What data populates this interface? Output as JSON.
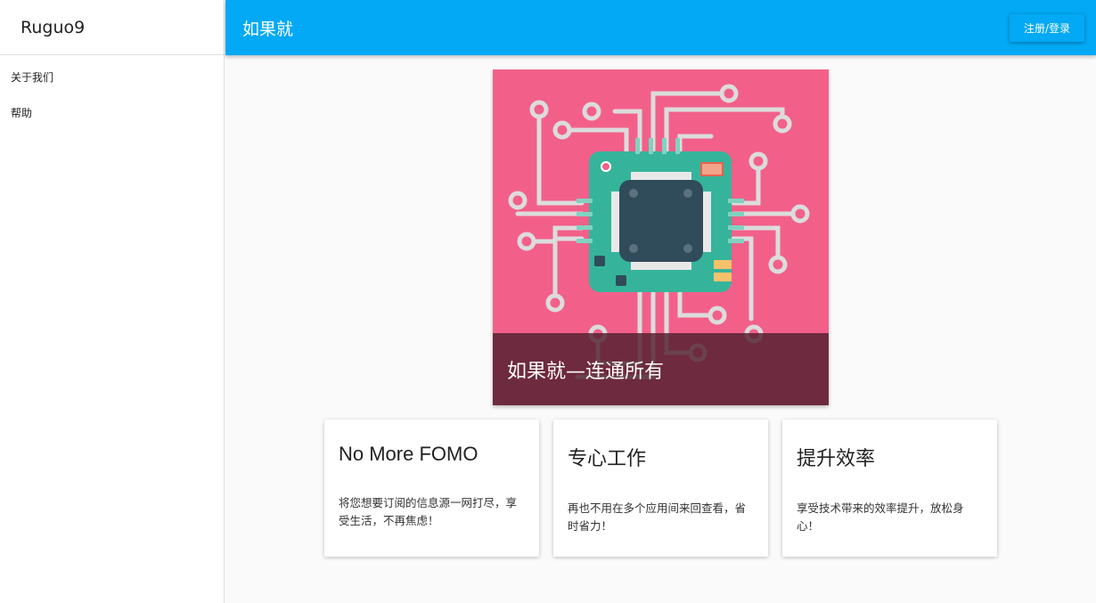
{
  "sidebar": {
    "brand": "Ruguo9",
    "items": [
      {
        "label": "关于我们"
      },
      {
        "label": "帮助"
      }
    ]
  },
  "appbar": {
    "title": "如果就",
    "login_label": "注册/登录",
    "color": "#03a9f4"
  },
  "hero": {
    "caption": "如果就—连通所有",
    "background": "#f2608a",
    "image": "circuit-chip-illustration"
  },
  "cards": [
    {
      "title": "No More FOMO",
      "text": "将您想要订阅的信息源一网打尽，享受生活，不再焦虑！"
    },
    {
      "title": "专心工作",
      "text": "再也不用在多个应用间来回查看，省时省力！"
    },
    {
      "title": "提升效率",
      "text": "享受技术带来的效率提升，放松身心！"
    }
  ]
}
